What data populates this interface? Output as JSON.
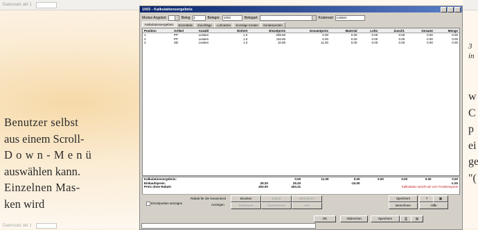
{
  "page": {
    "left_lines": [
      "Benutzer selbst",
      "aus einem Scroll-",
      "Down-Menü",
      "auswählen kann.",
      "Einzelnen Mas-",
      "ken wird"
    ],
    "right_caption": [
      "3",
      "in"
    ],
    "right_lines": [
      "w",
      "C",
      "p",
      "ei",
      "ge",
      "\"("
    ]
  },
  "background_ui": {
    "top_label": "Datensatz  akt 1",
    "bottom_label": "Datensatz  akt 1"
  },
  "dialog": {
    "title": "1003 - Kalkulationsergebnis",
    "header": {
      "label1": "Modus  Angebot",
      "label2": "Beleg",
      "value1": "1",
      "label3": "Belegnr.",
      "value2": "1003",
      "label4": "Belegart",
      "label5": "Kostenart",
      "value3": "Leisten"
    },
    "tabs": [
      "Kalkulationsergebnis",
      "Einzelteile",
      "Zuschläge",
      "Lohnarten",
      "Sonstige Kosten",
      "Sonderposten"
    ],
    "grid": {
      "columns": [
        "Position",
        "Artikel",
        "Anzahl",
        "Einheit",
        "Einzelpreis",
        "Gesamtpreis",
        "Material",
        "Lohn",
        "Zuschl.",
        "Gesamt",
        "Menge"
      ],
      "rows": [
        [
          "1",
          "PP",
          "Leisten",
          "1.0",
          "205.50",
          "0.00",
          "0.00",
          "0.00",
          "0.00",
          "0.00",
          "0.00"
        ],
        [
          "2",
          "PP",
          "Leisten",
          "1.0",
          "116.80",
          "0.00",
          "0.00",
          "0.00",
          "0.00",
          "0.00",
          "0.00"
        ],
        [
          "3",
          "SB",
          "Leisten",
          "1.0",
          "10.80",
          "11.00",
          "0.00",
          "0.00",
          "0.00",
          "0.00",
          "0.00"
        ]
      ]
    },
    "summary": {
      "rows": [
        [
          "Kalkulationsergebnis:",
          "",
          "0.00",
          "11.00",
          "0.00",
          "0.00",
          "0.00",
          "0.00",
          "0.00"
        ],
        [
          "Einkaufspreis:",
          "25.20",
          "25.20",
          "",
          "-24.00",
          "",
          "",
          "",
          "-1.00"
        ],
        [
          "Preis ohne Rabatt:",
          "403.00",
          "403.31",
          "",
          "",
          "",
          "",
          "",
          ""
        ]
      ],
      "warning": "Kalkulation weicht ab vom Positionspreis"
    },
    "buttons": {
      "label_left": "Rabatt für die Gesamtzeit",
      "label_left2": "Anzeigen",
      "checkbox_label": "Einzelposten anzeigen",
      "b1": "Drucken",
      "b2": "Dokument",
      "b3": "Export",
      "b4": "Übernehmen",
      "b5": "Berechnen",
      "b6": "Info",
      "b7": "OK",
      "b8": "Abbrechen",
      "b9": "Speichern",
      "b10": "Hilfe"
    }
  }
}
